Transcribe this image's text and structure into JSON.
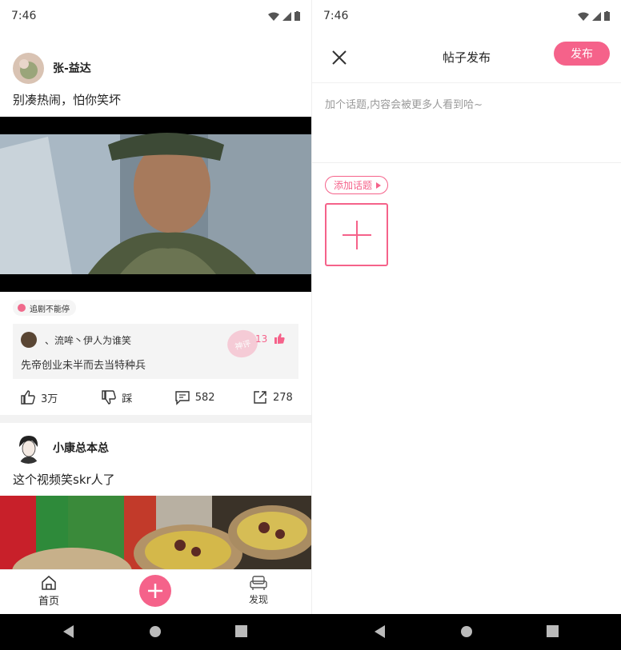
{
  "status_bar": {
    "time": "7:46"
  },
  "feed": {
    "posts": [
      {
        "author": "张-益达",
        "text": "别凑热闹，怕你笑坏",
        "tag": "追剧不能停",
        "top_comment": {
          "author": "、流哞丶伊人为谁笑",
          "text": "先帝创业未半而去当特种兵",
          "likes": "13",
          "stamp": "神评"
        },
        "actions": {
          "like": "3万",
          "dislike": "踩",
          "comments": "582",
          "shares": "278"
        }
      },
      {
        "author": "小康总本总",
        "text": "这个视频笑skr人了"
      }
    ]
  },
  "bottom_nav": {
    "home_label": "首页",
    "discover_label": "发现"
  },
  "composer": {
    "title": "帖子发布",
    "publish_label": "发布",
    "input_placeholder": "加个话题,内容会被更多人看到哈~",
    "add_topic_label": "添加话题"
  },
  "colors": {
    "accent": "#f5628a"
  }
}
